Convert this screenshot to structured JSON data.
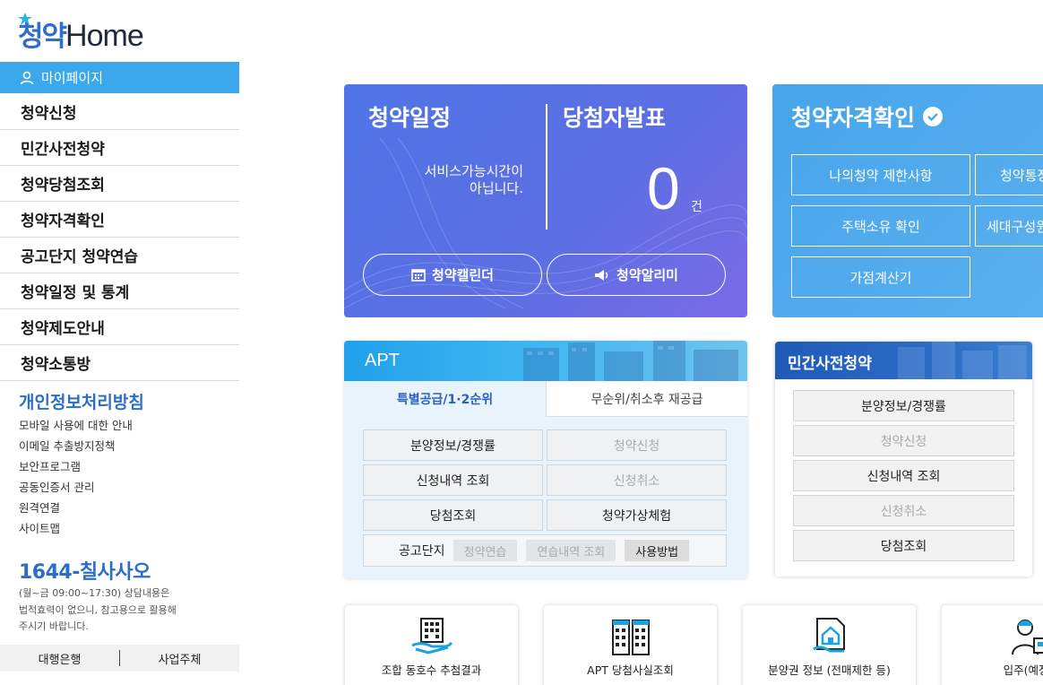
{
  "logo": {
    "korean": "청약",
    "english": "Home"
  },
  "sidebar": {
    "mypage": "마이페이지",
    "nav": [
      {
        "label": "청약신청"
      },
      {
        "label": "민간사전청약"
      },
      {
        "label": "청약당첨조회"
      },
      {
        "label": "청약자격확인"
      },
      {
        "label": "공고단지 청약연습"
      },
      {
        "label": "청약일정 및 통계"
      },
      {
        "label": "청약제도안내"
      },
      {
        "label": "청약소통방"
      }
    ],
    "privacy": "개인정보처리방침",
    "sublinks": [
      {
        "label": "모바일 사용에 대한 안내"
      },
      {
        "label": "이메일 추출방지정책"
      },
      {
        "label": "보안프로그램"
      },
      {
        "label": "공동인증서 관리"
      },
      {
        "label": "원격연결"
      },
      {
        "label": "사이트맵"
      }
    ],
    "phone": "1644-칠사사오",
    "hours": [
      "(월~금 09:00~17:30) 상담내용은",
      "법적효력이 없으니, 참고용으로 활용해",
      "주시기 바랍니다."
    ],
    "footer": {
      "bank": "대행은행",
      "operator": "사업주체"
    }
  },
  "schedule": {
    "title": "청약일정",
    "winners_title": "당첨자발표",
    "message_line1": "서비스가능시간이",
    "message_line2": "아닙니다.",
    "count": "0",
    "unit": "건",
    "calendar_btn": "청약캘린더",
    "alarm_btn": "청약알리미"
  },
  "eligibility": {
    "title": "청약자격확인",
    "buttons": [
      "나의청약 제한사항",
      "청약통장",
      "주택소유 확인",
      "세대구성원",
      "가점계산기"
    ]
  },
  "apt": {
    "title": "APT",
    "tab_special": "특별공급/1·2순위",
    "tab_unranked": "무순위/취소후 재공급",
    "buttons": [
      {
        "label": "분양정보/경쟁률",
        "enabled": true
      },
      {
        "label": "청약신청",
        "enabled": false
      },
      {
        "label": "신청내역 조회",
        "enabled": true
      },
      {
        "label": "신청취소",
        "enabled": false
      },
      {
        "label": "당첨조회",
        "enabled": true
      },
      {
        "label": "청약가상체험",
        "enabled": true
      }
    ],
    "gongo_label": "공고단지",
    "chips": [
      {
        "label": "청약연습",
        "enabled": false
      },
      {
        "label": "연습내역 조회",
        "enabled": false
      },
      {
        "label": "사용방법",
        "enabled": true
      }
    ]
  },
  "private": {
    "title": "민간사전청약",
    "buttons": [
      {
        "label": "분양정보/경쟁률",
        "enabled": true
      },
      {
        "label": "청약신청",
        "enabled": false
      },
      {
        "label": "신청내역 조회",
        "enabled": true
      },
      {
        "label": "신청취소",
        "enabled": false
      },
      {
        "label": "당첨조회",
        "enabled": true
      }
    ]
  },
  "quick": [
    {
      "label": "조합 동호수 추첨결과",
      "icon": "building-hand-icon"
    },
    {
      "label": "APT 당첨사실조회",
      "icon": "apartment-icon"
    },
    {
      "label": "분양권 정보 (전매제한 등)",
      "icon": "document-house-icon"
    },
    {
      "label": "입주(예정)",
      "icon": "resident-icon"
    }
  ],
  "colors": {
    "accent": "#3ba8ec",
    "brand_blue": "#2b6ec9",
    "schedule_card": "#5570e4",
    "eligibility_card": "#4fa9ec",
    "apt_header": "#2aa6ec",
    "private_header": "#2462c0"
  }
}
